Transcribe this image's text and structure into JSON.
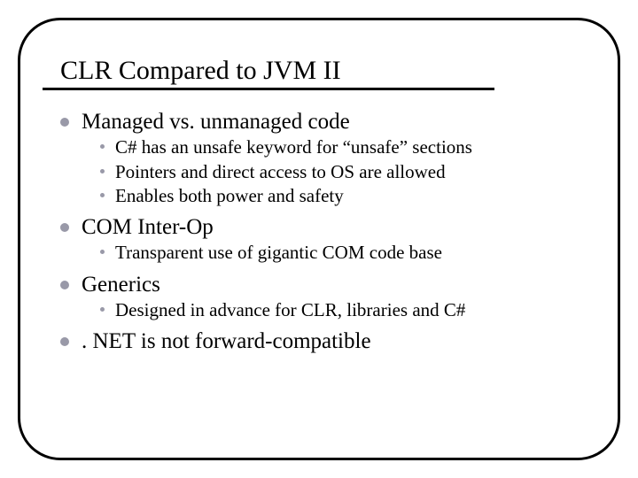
{
  "title": "CLR Compared to JVM II",
  "bullets": [
    {
      "text": "Managed vs. unmanaged code",
      "sub": [
        "C# has an unsafe keyword for “unsafe” sections",
        "Pointers and direct access to OS are allowed",
        "Enables both power and safety"
      ]
    },
    {
      "text": "COM Inter-Op",
      "sub": [
        "Transparent use of gigantic COM code base"
      ]
    },
    {
      "text": "Generics",
      "sub": [
        "Designed in advance for CLR, libraries and C#"
      ]
    },
    {
      "text": ". NET is not forward-compatible",
      "sub": []
    }
  ]
}
